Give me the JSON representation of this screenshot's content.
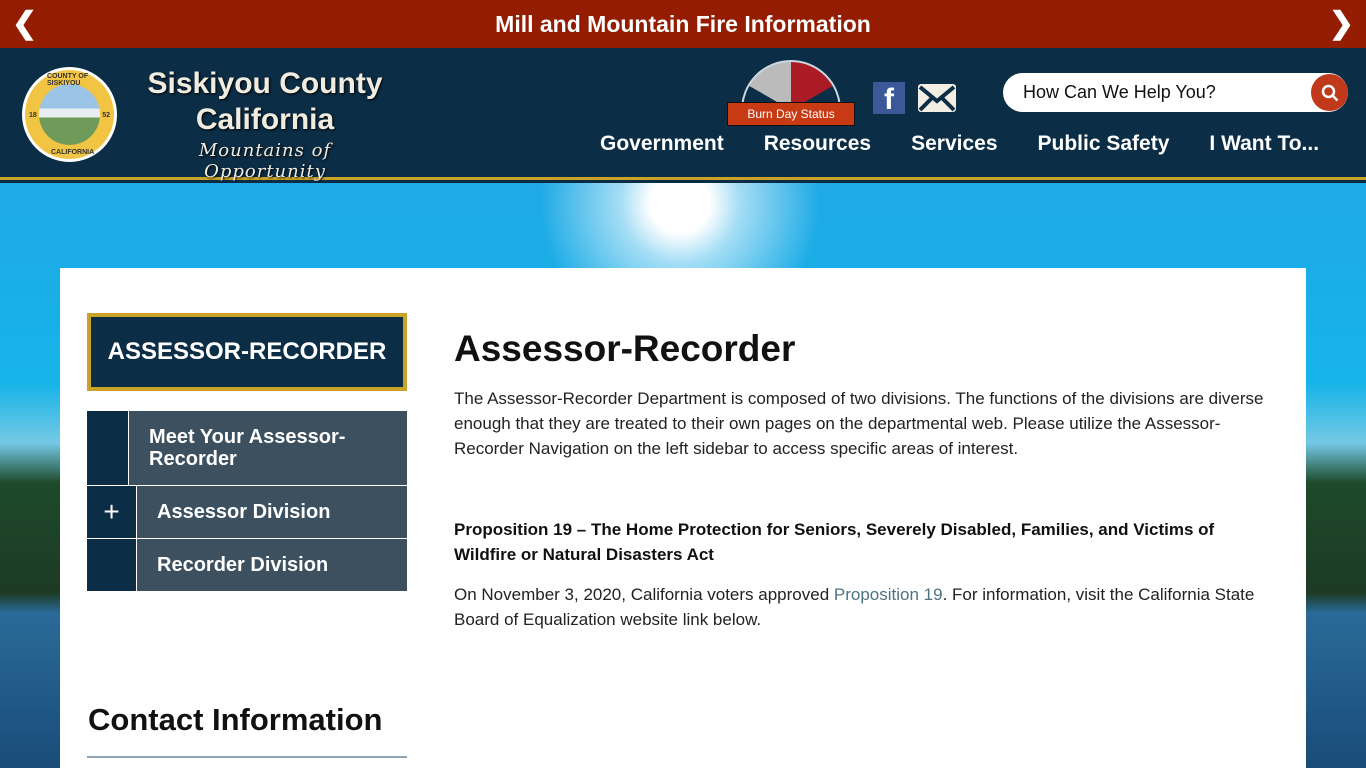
{
  "alert": {
    "title": "Mill and Mountain Fire Information",
    "prev_icon": "chevron-left",
    "next_icon": "chevron-right"
  },
  "header": {
    "seal": {
      "top": "COUNTY OF SISKIYOU",
      "left": "18",
      "right": "52",
      "bottom": "CALIFORNIA"
    },
    "brand_line1": "Siskiyou County",
    "brand_line2": "California",
    "tagline": "Mountains of Opportunity",
    "burn_label": "Burn Day Status",
    "facebook_icon": "facebook",
    "mail_icon": "envelope",
    "search_placeholder": "How Can We Help You?"
  },
  "nav": [
    "Government",
    "Resources",
    "Services",
    "Public Safety",
    "I Want To..."
  ],
  "sidebar": {
    "department": "ASSESSOR-RECORDER",
    "items": [
      {
        "label": "Meet Your Assessor-Recorder",
        "toggle": ""
      },
      {
        "label": "Assessor Division",
        "toggle": "+"
      },
      {
        "label": "Recorder Division",
        "toggle": ""
      }
    ]
  },
  "main": {
    "title": "Assessor-Recorder",
    "intro": "The Assessor-Recorder Department is composed of two divisions.  The functions of the divisions are diverse enough that they are treated to their own pages on the departmental web.  Please utilize the Assessor-Recorder Navigation on the left sidebar to access specific areas of interest.",
    "prop_heading": "Proposition 19 – The Home Protection for Seniors, Severely Disabled, Families, and Victims of Wildfire or Natural Disasters Act",
    "prop_before": "On November 3, 2020, California voters approved ",
    "prop_link": "Proposition 19",
    "prop_after": ". For information, visit the California State Board of Equalization website link below."
  },
  "contact_title": "Contact Information",
  "colors": {
    "alert": "#941c00",
    "header": "#0b2d45",
    "gold": "#c9a227",
    "search_button": "#c0391b",
    "link": "#4d7384"
  }
}
